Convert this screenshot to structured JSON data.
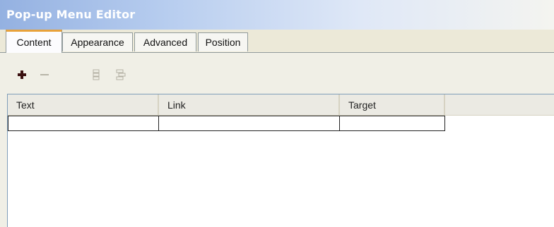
{
  "window": {
    "title": "Pop-up Menu Editor"
  },
  "tabs": [
    {
      "label": "Content",
      "active": true
    },
    {
      "label": "Appearance",
      "active": false
    },
    {
      "label": "Advanced",
      "active": false
    },
    {
      "label": "Position",
      "active": false
    }
  ],
  "toolbar": {
    "add_icon": "plus-icon",
    "remove_icon": "minus-icon",
    "move_up_icon": "move-up-icon",
    "move_down_icon": "move-down-icon"
  },
  "table": {
    "columns": [
      "Text",
      "Link",
      "Target"
    ],
    "rows": [
      [
        "",
        "",
        ""
      ]
    ]
  },
  "colors": {
    "active_tab_accent": "#e8a23a",
    "title_gradient_start": "#94b1e1",
    "panel_background": "#ece9d8"
  }
}
